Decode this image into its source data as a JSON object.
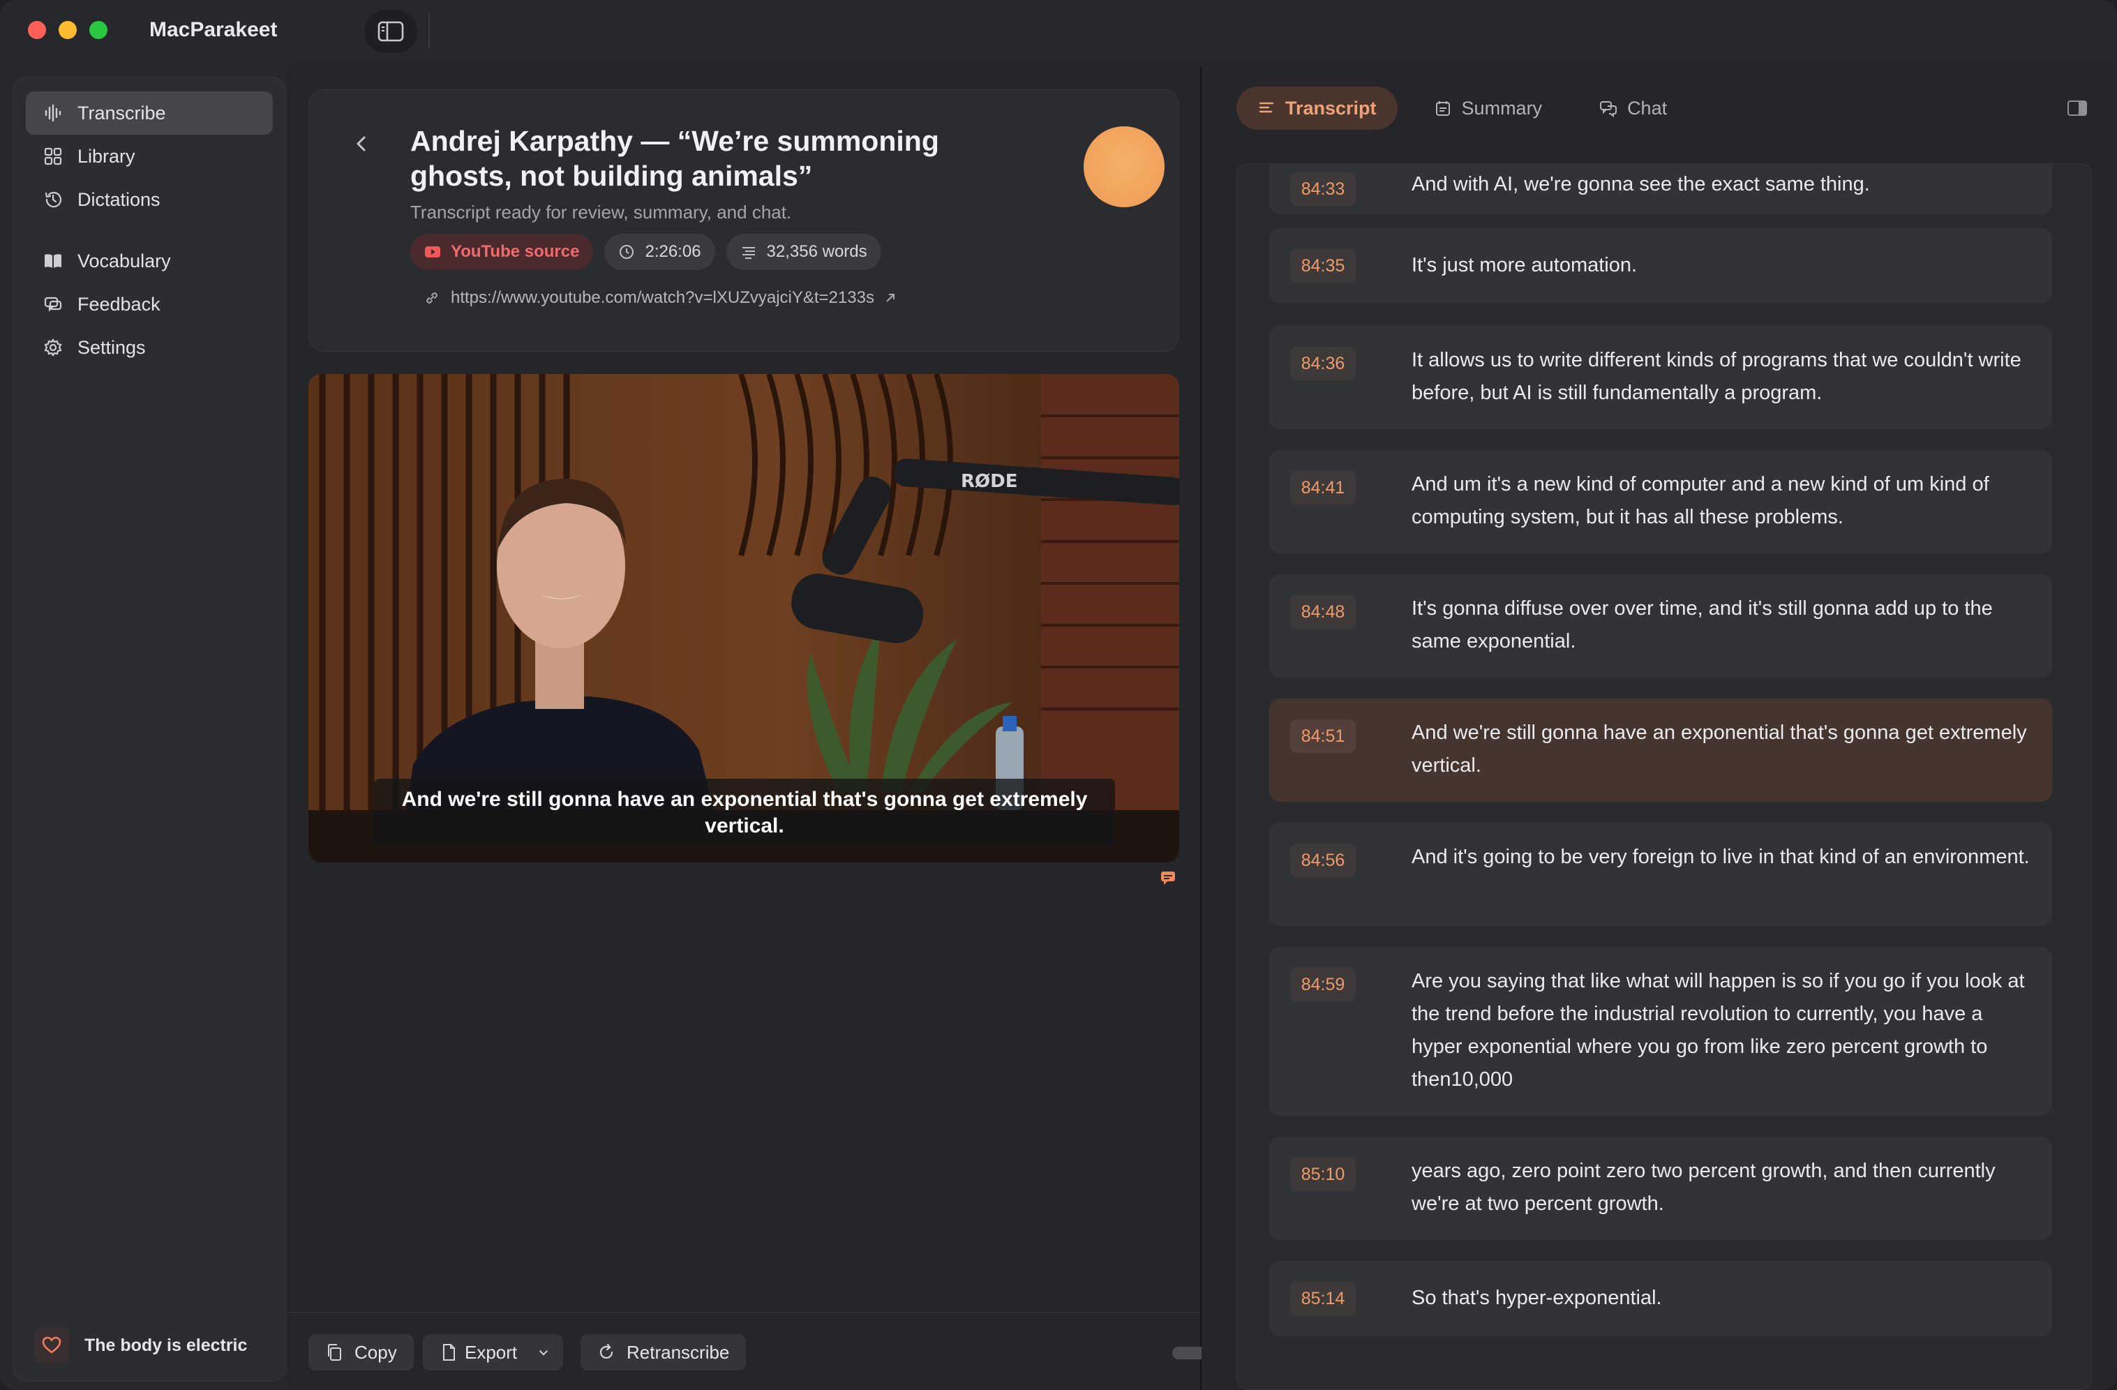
{
  "app": {
    "title": "MacParakeet"
  },
  "sidebar": {
    "items": [
      {
        "label": "Transcribe",
        "icon": "waveform-icon",
        "active": true
      },
      {
        "label": "Library",
        "icon": "grid-icon"
      },
      {
        "label": "Dictations",
        "icon": "history-icon"
      },
      {
        "label": "Vocabulary",
        "icon": "book-icon"
      },
      {
        "label": "Feedback",
        "icon": "feedback-icon"
      },
      {
        "label": "Settings",
        "icon": "gear-icon"
      }
    ],
    "footer": {
      "label": "The body is electric",
      "icon": "heart-icon"
    }
  },
  "header": {
    "title": "Andrej Karpathy — “We’re summoning ghosts, not building animals”",
    "subtitle": "Transcript ready for review, summary, and chat.",
    "badges": {
      "source": "YouTube source",
      "duration": "2:26:06",
      "words": "32,356 words"
    },
    "url": "https://www.youtube.com/watch?v=lXUZvyajciY&t=2133s"
  },
  "video": {
    "caption": "And we're still gonna have an exponential that's gonna get extremely vertical.",
    "mic_brand": "RØDE"
  },
  "actions": {
    "copy": "Copy",
    "export": "Export",
    "retranscribe": "Retranscribe"
  },
  "tabs": [
    {
      "label": "Transcript",
      "active": true
    },
    {
      "label": "Summary"
    },
    {
      "label": "Chat"
    }
  ],
  "colors": {
    "accent": "#ee9a6a",
    "active_tab_bg": "#4a352d",
    "active_segment_bg": "#44352f",
    "youtube_red": "#f26a6a"
  },
  "transcript": [
    {
      "time": "84:33",
      "text": "And with AI, we're gonna see the exact same thing."
    },
    {
      "time": "84:35",
      "text": "It's just more automation."
    },
    {
      "time": "84:36",
      "text": "It allows us to write different kinds of programs that we couldn't write before, but AI is still fundamentally a program."
    },
    {
      "time": "84:41",
      "text": "And um it's a new kind of computer and a new kind of um kind of computing system, but it has all these problems."
    },
    {
      "time": "84:48",
      "text": "It's gonna diffuse over over time, and it's still gonna add up to the same exponential."
    },
    {
      "time": "84:51",
      "text": "And we're still gonna have an exponential that's gonna get extremely vertical.",
      "active": true
    },
    {
      "time": "84:56",
      "text": "And it's going to be very foreign to live in that kind of an environment."
    },
    {
      "time": "84:59",
      "text": "Are you saying that like what will happen is so if you go if you look at the trend before the industrial revolution to currently, you have a hyper exponential where you go from like zero percent growth to then10,000"
    },
    {
      "time": "85:10",
      "text": "years ago, zero point zero two percent growth, and then currently we're at two percent growth."
    },
    {
      "time": "85:14",
      "text": "So that's hyper-exponential."
    }
  ]
}
